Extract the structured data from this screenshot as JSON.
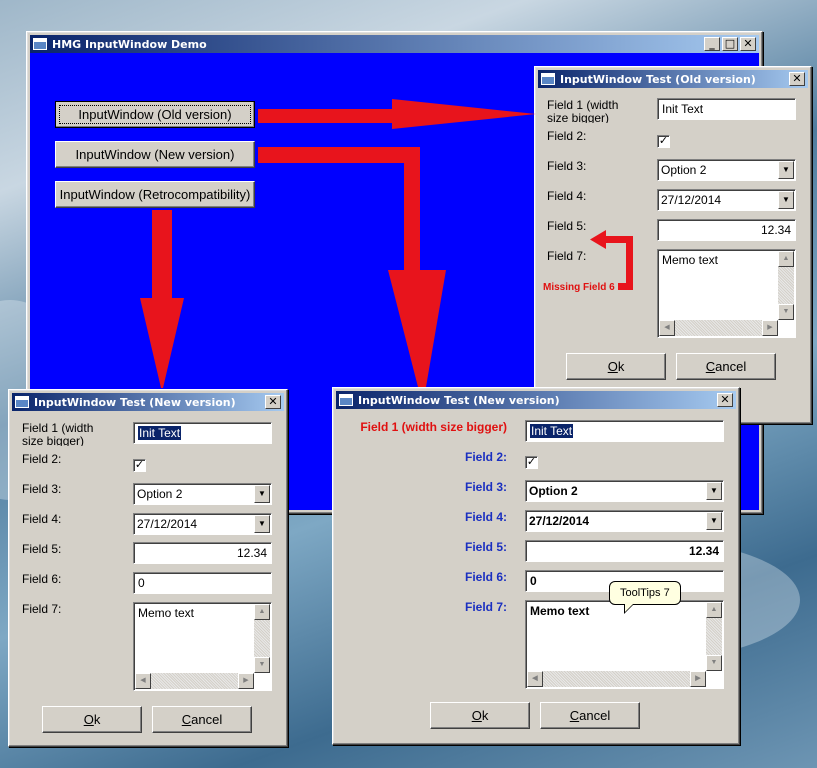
{
  "main_window": {
    "title": "HMG InputWindow Demo",
    "buttons": {
      "old": "InputWindow (Old version)",
      "new": "InputWindow (New version)",
      "retro": "InputWindow (Retrocompatibility)"
    },
    "client_color": "#0000ff"
  },
  "annotation": {
    "missing_field": "Missing Field 6",
    "color": "#e8141c"
  },
  "old_dialog": {
    "title": "InputWindow Test (Old version)",
    "labels": {
      "f1": "Field 1 (width size bigger)",
      "f2": "Field 2:",
      "f3": "Field 3:",
      "f4": "Field 4:",
      "f5": "Field 5:",
      "f7": "Field 7:"
    },
    "values": {
      "f1": "Init Text",
      "f3": "Option 2",
      "f4": "27/12/2014",
      "f5": "12.34",
      "f7": "Memo text"
    },
    "ok_underline": "O",
    "ok_rest": "k",
    "cancel_underline": "C",
    "cancel_rest": "ancel"
  },
  "new_dialog": {
    "title": "InputWindow Test (New version)",
    "labels": {
      "f1": "Field 1 (width size bigger)",
      "f2": "Field 2:",
      "f3": "Field 3:",
      "f4": "Field 4:",
      "f5": "Field 5:",
      "f6": "Field 6:",
      "f7": "Field 7:"
    },
    "values": {
      "f1": "Init Text",
      "f3": "Option 2",
      "f4": "27/12/2014",
      "f5": "12.34",
      "f6": "0",
      "f7": "Memo text"
    },
    "ok_underline": "O",
    "ok_rest": "k",
    "cancel_underline": "C",
    "cancel_rest": "ancel"
  },
  "styled_dialog": {
    "title": "InputWindow Test (New version)",
    "labels": {
      "f1": "Field 1 (width size bigger)",
      "f2": "Field 2:",
      "f3": "Field 3:",
      "f4": "Field 4:",
      "f5": "Field 5:",
      "f6": "Field 6:",
      "f7": "Field 7:"
    },
    "values": {
      "f1": "Init Text",
      "f3": "Option 2",
      "f4": "27/12/2014",
      "f5": "12.34",
      "f6": "0",
      "f7": "Memo text"
    },
    "tooltip": "ToolTips 7",
    "ok_underline": "O",
    "ok_rest": "k",
    "cancel_underline": "C",
    "cancel_rest": "ancel"
  },
  "icons": {
    "minimize": "_",
    "maximize": "□",
    "close": "✕",
    "check": "✓",
    "dropdown": "▼",
    "scroll_up": "▲",
    "scroll_down": "▼",
    "scroll_left": "◀",
    "scroll_right": "▶"
  }
}
